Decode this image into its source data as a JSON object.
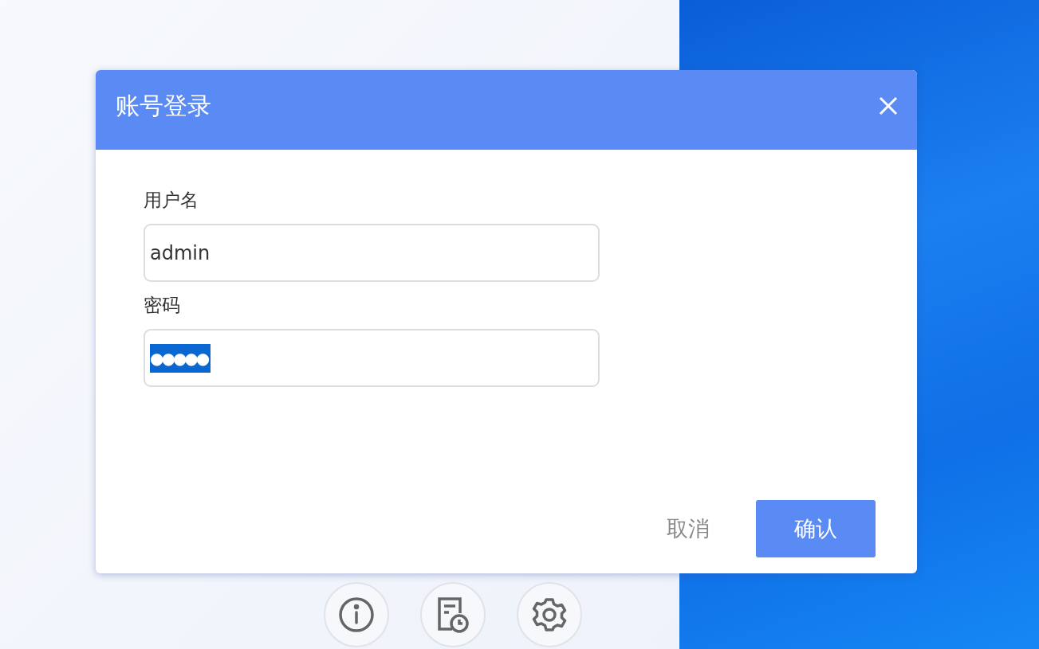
{
  "dialog": {
    "title": "账号登录",
    "fields": [
      {
        "label": "用户名",
        "value": "admin",
        "kind": "text",
        "selected": false
      },
      {
        "label": "密码",
        "value": "●●●●●",
        "kind": "password",
        "selected": true
      }
    ],
    "buttons": [
      {
        "label": "取消",
        "kind": "secondary"
      },
      {
        "label": "确认",
        "kind": "primary"
      }
    ]
  },
  "toolbar": [
    {
      "kind": "info"
    },
    {
      "kind": "log"
    },
    {
      "kind": "settings"
    }
  ]
}
